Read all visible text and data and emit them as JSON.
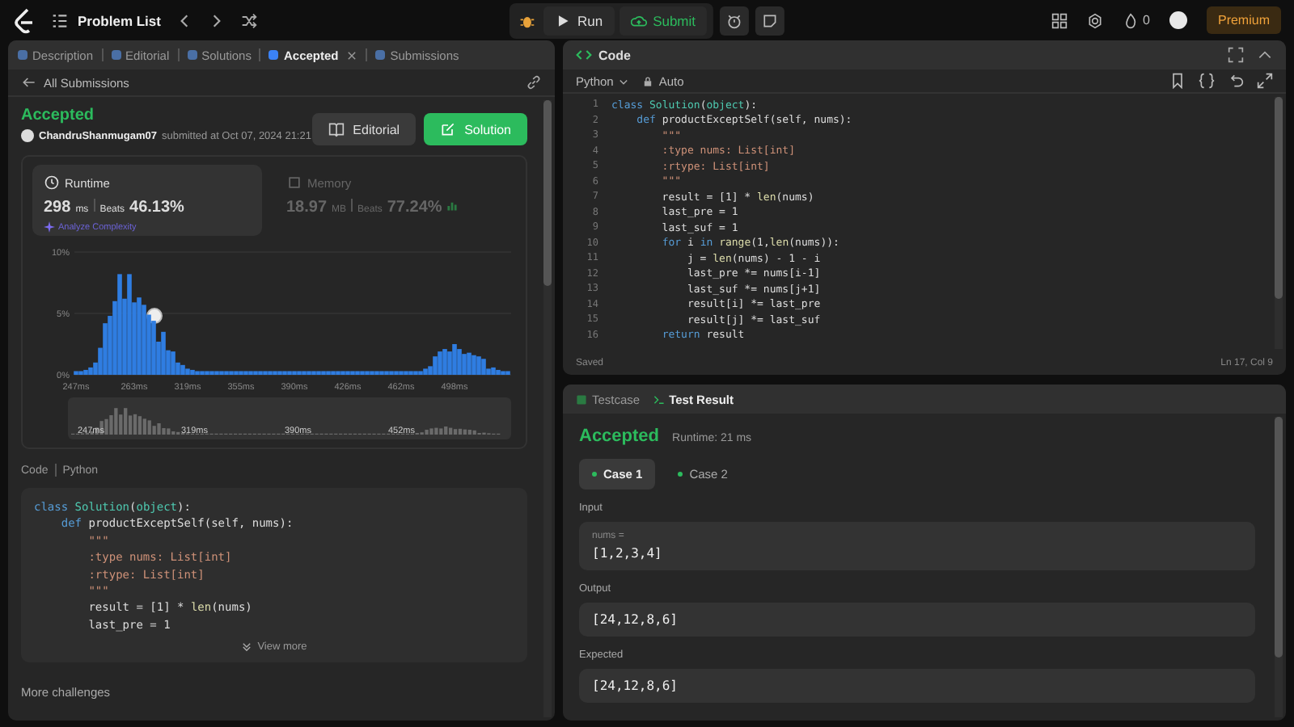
{
  "topbar": {
    "title": "Problem List",
    "run": "Run",
    "submit": "Submit",
    "streak": "0",
    "premium": "Premium"
  },
  "left_tabs": [
    {
      "label": "Description",
      "selected": false,
      "closable": false
    },
    {
      "label": "Editorial",
      "selected": false,
      "closable": false
    },
    {
      "label": "Solutions",
      "selected": false,
      "closable": false
    },
    {
      "label": "Accepted",
      "selected": true,
      "closable": true
    },
    {
      "label": "Submissions",
      "selected": false,
      "closable": false
    }
  ],
  "back_link": "All Submissions",
  "submission": {
    "status": "Accepted",
    "user": "ChandruShanmugam07",
    "submitted": "submitted at Oct 07, 2024 21:21",
    "editorial": "Editorial",
    "solution": "Solution"
  },
  "metrics": [
    {
      "title": "Runtime",
      "value": "298",
      "unit": "ms",
      "beats_label": "Beats",
      "beats": "46.13%",
      "selected": true
    },
    {
      "title": "Memory",
      "value": "18.97",
      "unit": "MB",
      "beats_label": "Beats",
      "beats": "77.24%",
      "selected": false
    }
  ],
  "analyze": "Analyze Complexity",
  "chart_data": {
    "type": "bar",
    "ylim": [
      0,
      10
    ],
    "yticks": [
      {
        "value": 0,
        "label": "0%"
      },
      {
        "value": 5,
        "label": "5%"
      },
      {
        "value": 10,
        "label": "10%"
      }
    ],
    "categories": [
      "247ms",
      null,
      null,
      null,
      null,
      null,
      null,
      null,
      null,
      null,
      null,
      null,
      "263ms",
      null,
      null,
      null,
      null,
      null,
      null,
      null,
      null,
      null,
      null,
      "319ms",
      null,
      null,
      null,
      null,
      null,
      null,
      null,
      null,
      null,
      null,
      "355ms",
      null,
      null,
      null,
      null,
      null,
      null,
      null,
      null,
      null,
      null,
      "390ms",
      null,
      null,
      null,
      null,
      null,
      null,
      null,
      null,
      null,
      null,
      "426ms",
      null,
      null,
      null,
      null,
      null,
      null,
      null,
      null,
      null,
      null,
      "462ms",
      null,
      null,
      null,
      null,
      null,
      null,
      null,
      null,
      null,
      null,
      "498ms",
      null,
      null,
      null,
      null,
      null,
      null,
      null,
      null,
      null,
      null,
      null
    ],
    "values": [
      0.3,
      0.3,
      0.4,
      0.6,
      1.0,
      2.2,
      4.2,
      4.8,
      6.0,
      8.2,
      6.2,
      8.2,
      5.9,
      6.3,
      5.7,
      4.9,
      4.4,
      2.7,
      3.5,
      2.0,
      1.9,
      1.0,
      0.8,
      0.5,
      0.4,
      0.3,
      0.3,
      0.3,
      0.3,
      0.3,
      0.3,
      0.3,
      0.3,
      0.3,
      0.3,
      0.3,
      0.3,
      0.3,
      0.3,
      0.3,
      0.3,
      0.3,
      0.3,
      0.3,
      0.3,
      0.3,
      0.3,
      0.3,
      0.3,
      0.3,
      0.3,
      0.3,
      0.3,
      0.3,
      0.3,
      0.3,
      0.3,
      0.3,
      0.3,
      0.3,
      0.3,
      0.3,
      0.3,
      0.3,
      0.3,
      0.3,
      0.3,
      0.3,
      0.3,
      0.3,
      0.3,
      0.3,
      0.5,
      0.7,
      1.5,
      1.9,
      2.1,
      1.9,
      2.5,
      2.1,
      1.7,
      1.8,
      1.6,
      1.5,
      1.3,
      0.5,
      0.6,
      0.4,
      0.3,
      0.3
    ]
  },
  "overview_labels": [
    "247ms",
    "319ms",
    "390ms",
    "452ms"
  ],
  "code_preview": {
    "label": "Code",
    "language": "Python",
    "lines": [
      "class Solution(object):",
      "    def productExceptSelf(self, nums):",
      "        \"\"\"",
      "        :type nums: List[int]",
      "        :rtype: List[int]",
      "        \"\"\"",
      "        result = [1] * len(nums)",
      "        last_pre = 1"
    ],
    "view_more": "View more"
  },
  "more_challenges": "More challenges",
  "editor": {
    "title": "Code",
    "language": "Python",
    "mode": "Auto",
    "status": "Saved",
    "cursor": "Ln 17, Col 9",
    "lines": [
      {
        "n": "1",
        "code": "class Solution(object):"
      },
      {
        "n": "2",
        "code": "    def productExceptSelf(self, nums):"
      },
      {
        "n": "3",
        "code": "        \"\"\""
      },
      {
        "n": "4",
        "code": "        :type nums: List[int]"
      },
      {
        "n": "5",
        "code": "        :rtype: List[int]"
      },
      {
        "n": "6",
        "code": "        \"\"\""
      },
      {
        "n": "7",
        "code": "        result = [1] * len(nums)"
      },
      {
        "n": "8",
        "code": "        last_pre = 1"
      },
      {
        "n": "9",
        "code": "        last_suf = 1"
      },
      {
        "n": "10",
        "code": "        for i in range(1,len(nums)):"
      },
      {
        "n": "11",
        "code": "            j = len(nums) - 1 - i"
      },
      {
        "n": "12",
        "code": "            last_pre *= nums[i-1]"
      },
      {
        "n": "13",
        "code": "            last_suf *= nums[j+1]"
      },
      {
        "n": "14",
        "code": "            result[i] *= last_pre"
      },
      {
        "n": "15",
        "code": "            result[j] *= last_suf"
      },
      {
        "n": "16",
        "code": "        return result"
      }
    ]
  },
  "result_tabs": [
    {
      "label": "Testcase",
      "selected": false
    },
    {
      "label": "Test Result",
      "selected": true
    }
  ],
  "result": {
    "status": "Accepted",
    "runtime": "Runtime: 21 ms",
    "cases": [
      {
        "label": "Case 1",
        "selected": true
      },
      {
        "label": "Case 2",
        "selected": false
      }
    ],
    "sections": [
      {
        "label": "Input",
        "param": "nums =",
        "value": "[1,2,3,4]"
      },
      {
        "label": "Output",
        "value": "[24,12,8,6]"
      },
      {
        "label": "Expected",
        "value": "[24,12,8,6]"
      }
    ]
  }
}
